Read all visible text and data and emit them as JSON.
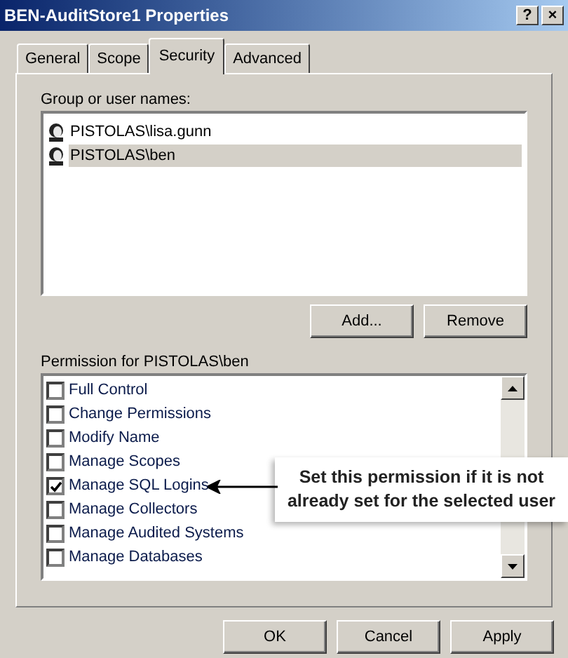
{
  "window": {
    "title": "BEN-AuditStore1 Properties",
    "controls": [
      "?",
      "×"
    ]
  },
  "tabs": [
    {
      "label": "General",
      "selected": false
    },
    {
      "label": "Scope",
      "selected": false
    },
    {
      "label": "Security",
      "selected": true
    },
    {
      "label": "Advanced",
      "selected": false
    }
  ],
  "users": {
    "label": "Group or user names:",
    "items": [
      {
        "name": "PISTOLAS\\lisa.gunn",
        "selected": false
      },
      {
        "name": "PISTOLAS\\ben",
        "selected": true
      }
    ],
    "buttons": [
      "Add...",
      "Remove"
    ]
  },
  "permissions": {
    "label": "Permission for PISTOLAS\\ben",
    "items": [
      {
        "name": "Full Control",
        "checked": false
      },
      {
        "name": "Change Permissions",
        "checked": false
      },
      {
        "name": "Modify Name",
        "checked": false
      },
      {
        "name": "Manage Scopes",
        "checked": false
      },
      {
        "name": "Manage SQL Logins",
        "checked": true
      },
      {
        "name": "Manage Collectors",
        "checked": false
      },
      {
        "name": "Manage Audited Systems",
        "checked": false
      },
      {
        "name": "Manage Databases",
        "checked": false
      }
    ]
  },
  "callout": {
    "lines": [
      "Set this permission if it is not",
      "already set for the selected user"
    ]
  },
  "buttons": [
    "OK",
    "Cancel",
    "Apply"
  ]
}
